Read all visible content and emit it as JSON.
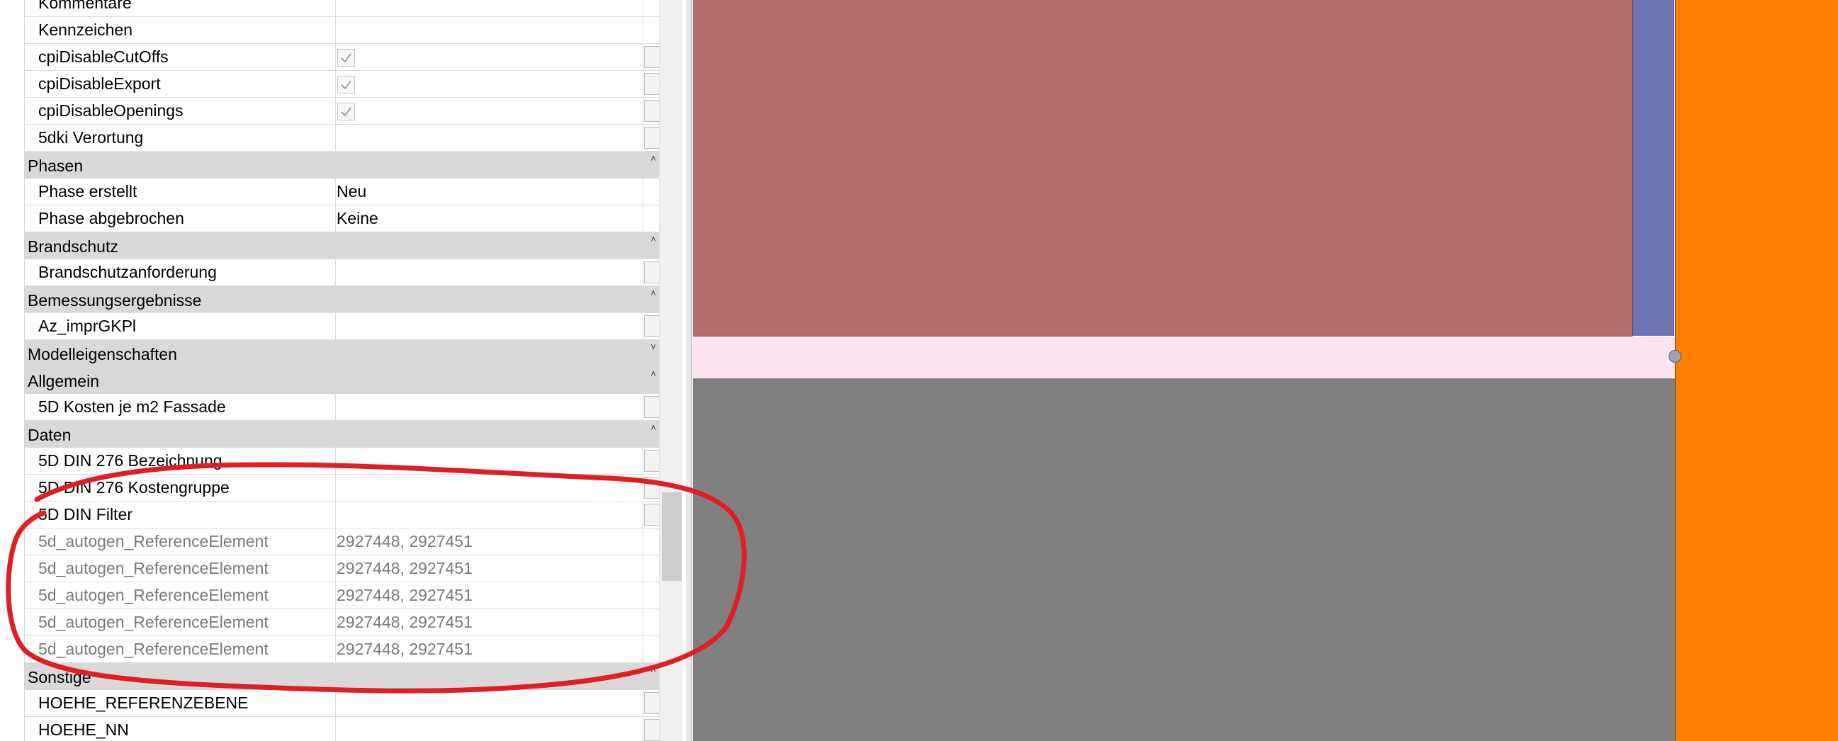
{
  "property_panel": {
    "rows": [
      {
        "type": "prop",
        "name": "Kommentare",
        "value": "",
        "button": false
      },
      {
        "type": "prop",
        "name": "Kennzeichen",
        "value": "",
        "button": false
      },
      {
        "type": "check",
        "name": "cpiDisableCutOffs",
        "checked": true
      },
      {
        "type": "check",
        "name": "cpiDisableExport",
        "checked": true
      },
      {
        "type": "check",
        "name": "cpiDisableOpenings",
        "checked": true
      },
      {
        "type": "prop",
        "name": "5dki Verortung",
        "value": "",
        "button": true
      },
      {
        "type": "group",
        "name": "Phasen",
        "toggle": "collapse"
      },
      {
        "type": "prop",
        "name": "Phase erstellt",
        "value": "Neu",
        "button": false
      },
      {
        "type": "prop",
        "name": "Phase abgebrochen",
        "value": "Keine",
        "button": false
      },
      {
        "type": "group",
        "name": "Brandschutz",
        "toggle": "collapse"
      },
      {
        "type": "prop",
        "name": "Brandschutzanforderung",
        "value": "",
        "button": true
      },
      {
        "type": "group",
        "name": "Bemessungsergebnisse",
        "toggle": "collapse"
      },
      {
        "type": "prop",
        "name": "Az_imprGKPl",
        "value": "",
        "button": true
      },
      {
        "type": "group",
        "name": "Modelleigenschaften",
        "toggle": "expand"
      },
      {
        "type": "group",
        "name": "Allgemein",
        "toggle": "collapse"
      },
      {
        "type": "prop",
        "name": "5D Kosten je m2 Fassade",
        "value": "",
        "button": true
      },
      {
        "type": "group",
        "name": "Daten",
        "toggle": "collapse"
      },
      {
        "type": "prop",
        "name": "5D DIN 276 Bezeichnung",
        "value": "",
        "button": true
      },
      {
        "type": "prop",
        "name": "5D DIN 276 Kostengruppe",
        "value": "",
        "button": true
      },
      {
        "type": "prop",
        "name": "5D DIN Filter",
        "value": "",
        "button": true
      },
      {
        "type": "prop",
        "name": "5d_autogen_ReferenceElement",
        "value": "2927448, 2927451",
        "button": false,
        "greyed": true
      },
      {
        "type": "prop",
        "name": "5d_autogen_ReferenceElement",
        "value": "2927448, 2927451",
        "button": false,
        "greyed": true
      },
      {
        "type": "prop",
        "name": "5d_autogen_ReferenceElement",
        "value": "2927448, 2927451",
        "button": false,
        "greyed": true
      },
      {
        "type": "prop",
        "name": "5d_autogen_ReferenceElement",
        "value": "2927448, 2927451",
        "button": false,
        "greyed": true
      },
      {
        "type": "prop",
        "name": "5d_autogen_ReferenceElement",
        "value": "2927448, 2927451",
        "button": false,
        "greyed": true
      },
      {
        "type": "group",
        "name": "Sonstige",
        "toggle": "collapse"
      },
      {
        "type": "prop",
        "name": "HOEHE_REFERENZEBENE",
        "value": "",
        "button": true
      },
      {
        "type": "prop",
        "name": "HOEHE_NN",
        "value": "",
        "button": true
      }
    ],
    "toggle_glyphs": {
      "collapse": "˄",
      "expand": "˅"
    }
  },
  "canvas": {
    "colors": {
      "red_block": "#b86d6d",
      "blue_block": "#6b73b1",
      "pink_band": "#fbe3ef",
      "grey_block": "#808080",
      "orange_block": "#ff7f00"
    }
  },
  "annotation": {
    "color": "#e02020",
    "icon": "freehand-ellipse"
  }
}
